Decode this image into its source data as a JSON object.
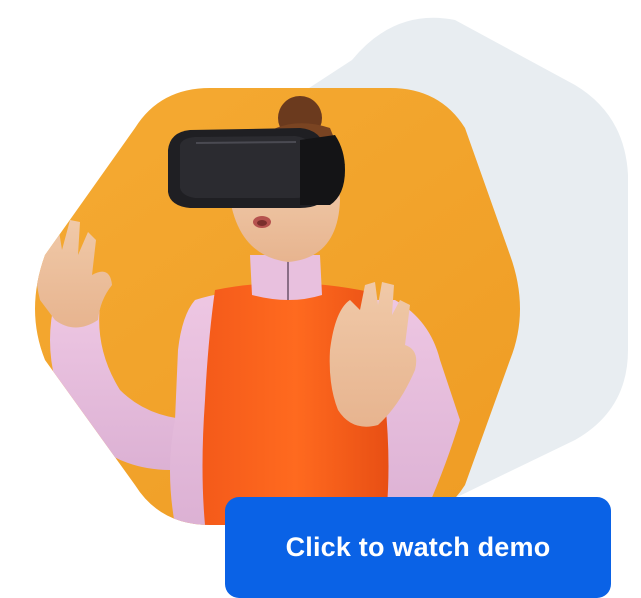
{
  "hero": {
    "image_alt": "Woman wearing a VR headset",
    "cta_label": "Click to watch demo"
  },
  "colors": {
    "background_hex": "#e8edf1",
    "photo_backdrop": "#f2a22a",
    "cta_bg": "#0a62e6",
    "cta_text": "#ffffff"
  },
  "icons": [
    "vr-headset-graphic"
  ]
}
